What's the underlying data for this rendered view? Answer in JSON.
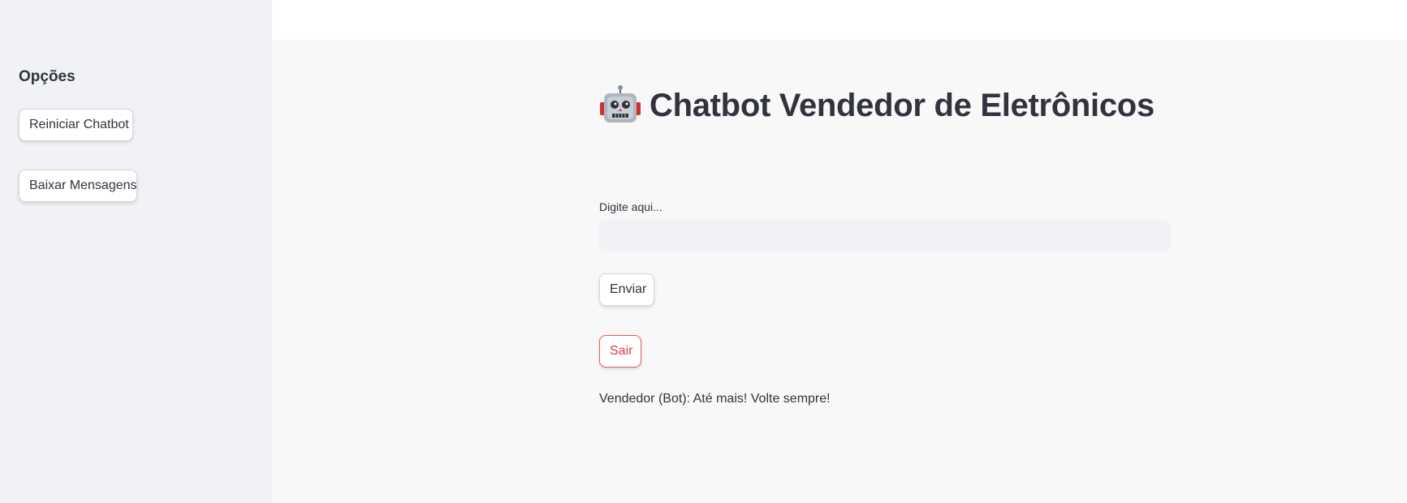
{
  "sidebar": {
    "title": "Opções",
    "buttons": [
      {
        "label": "Reiniciar Chatbot"
      },
      {
        "label": "Baixar Mensagens"
      }
    ]
  },
  "main": {
    "title_icon": "robot-icon",
    "title": "Chatbot Vendedor de Eletrônicos",
    "input": {
      "label": "Digite aqui...",
      "value": "",
      "placeholder": ""
    },
    "send_label": "Enviar",
    "exit_label": "Sair",
    "response": "Vendedor (Bot): Até mais! Volte sempre!"
  },
  "colors": {
    "sidebar_bg": "#f0f2f6",
    "main_bg": "#f8f8f9",
    "text": "#31333f",
    "exit_accent": "#e03c3c"
  }
}
